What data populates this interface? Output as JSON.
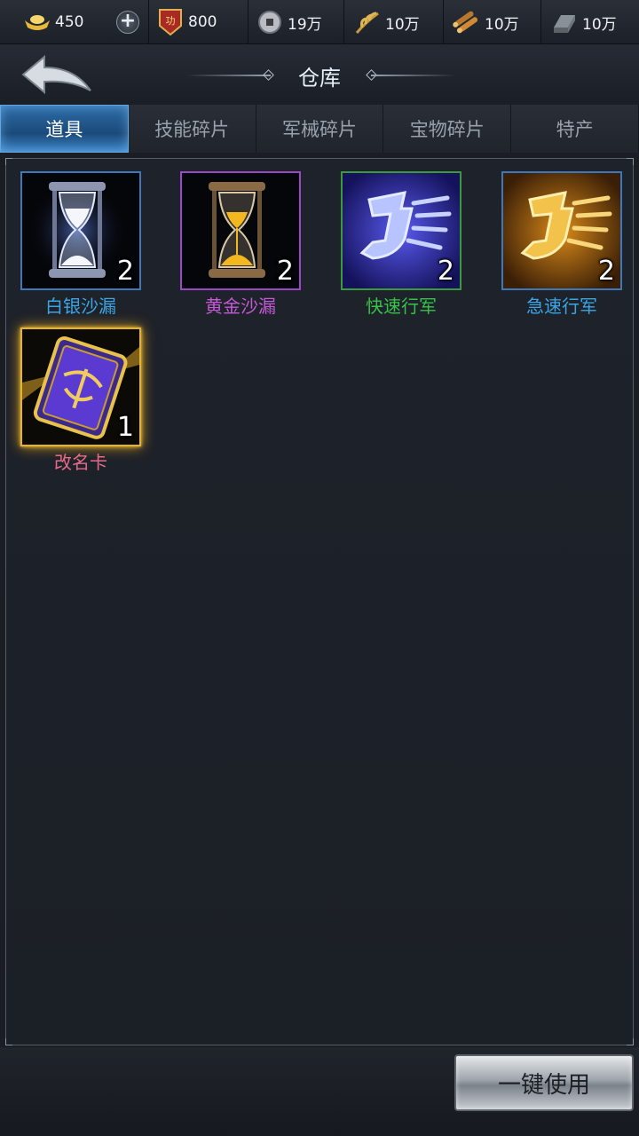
{
  "resources": [
    {
      "icon": "ingot-icon",
      "value": "450"
    },
    {
      "icon": "merit-badge-icon",
      "value": "800"
    },
    {
      "icon": "copper-coin-icon",
      "value": "19万"
    },
    {
      "icon": "grain-icon",
      "value": "10万"
    },
    {
      "icon": "wood-icon",
      "value": "10万"
    },
    {
      "icon": "iron-icon",
      "value": "10万"
    }
  ],
  "header": {
    "title": "仓库"
  },
  "tabs": [
    "道具",
    "技能碎片",
    "军械碎片",
    "宝物碎片",
    "特产"
  ],
  "active_tab": 0,
  "items": [
    {
      "name": "白银沙漏",
      "count": "2",
      "rarity_color": "#3aa6e8",
      "icon": "silver-hourglass-icon"
    },
    {
      "name": "黄金沙漏",
      "count": "2",
      "rarity_color": "#c45ad8",
      "icon": "gold-hourglass-icon"
    },
    {
      "name": "快速行军",
      "count": "2",
      "rarity_color": "#39c24a",
      "icon": "blue-boot-icon"
    },
    {
      "name": "急速行军",
      "count": "2",
      "rarity_color": "#3aa6e8",
      "icon": "gold-boot-icon"
    },
    {
      "name": "改名卡",
      "count": "1",
      "rarity_color": "#e86a8c",
      "icon": "rename-card-icon"
    }
  ],
  "footer": {
    "use_all_label": "一键使用"
  }
}
